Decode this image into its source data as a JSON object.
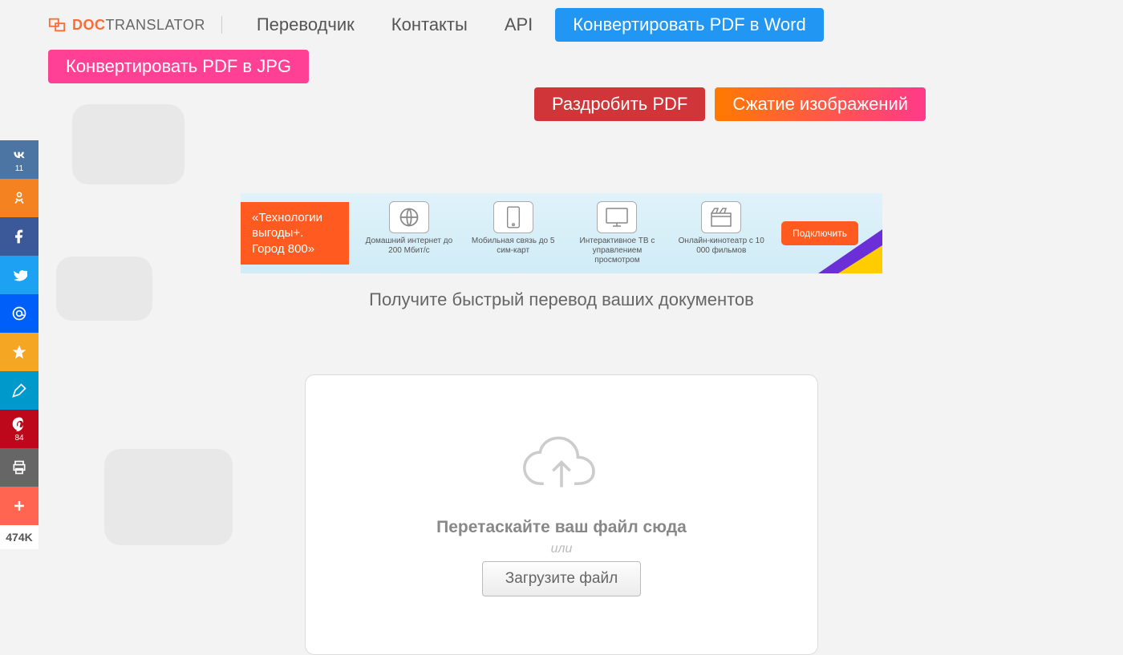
{
  "logo": {
    "brand_bold": "DOC",
    "brand_rest": "TRANSLATOR"
  },
  "nav": {
    "translator": "Переводчик",
    "contacts": "Контакты",
    "api": "API",
    "pdf_to_word": "Конвертировать PDF в Word",
    "pdf_to_jpg": "Конвертировать PDF в JPG",
    "split_pdf": "Раздробить PDF",
    "compress_img": "Сжатие изображений"
  },
  "social": {
    "vk_count": "11",
    "pin_count": "84",
    "total": "474K"
  },
  "ad": {
    "badge_line1": "«Технологии",
    "badge_line2": "выгоды+.",
    "badge_line3": "Город 800»",
    "items": [
      {
        "label": "Домашний интернет до 200 Мбит/с"
      },
      {
        "label": "Мобильная связь до 5 сим-карт"
      },
      {
        "label": "Интерактивное ТВ с управлением просмотром"
      },
      {
        "label": "Онлайн-кинотеатр с 10 000 фильмов"
      }
    ],
    "button": "Подключить"
  },
  "subtitle": "Получите быстрый перевод ваших документов",
  "dropzone": {
    "drag_text": "Перетаскайте ваш файл сюда",
    "or": "или",
    "button": "Загрузите файл"
  }
}
